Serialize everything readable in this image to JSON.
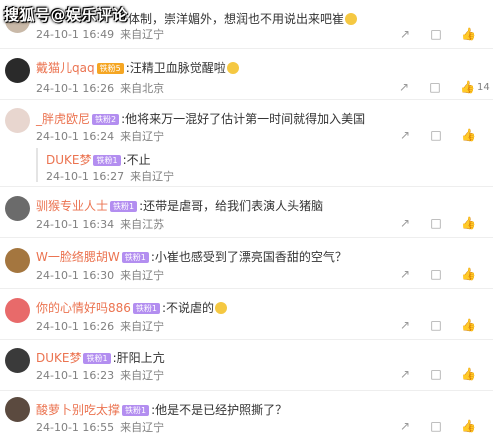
{
  "watermark": "搜狐号@娱乐评论",
  "top": {
    "text": "体制，崇洋媚外，想润也不用说出来吧崔",
    "date": "24-10-1 16:49",
    "location": "来自辽宁"
  },
  "comments": [
    {
      "name": "戴猫儿qaq",
      "badge": "铁粉5",
      "badge_style": "gold",
      "text": ":汪精卫血脉觉醒啦",
      "date": "24-10-1 16:26",
      "location": "来自北京",
      "likes": "14"
    },
    {
      "name": "_胖虎欧尼",
      "badge": "铁粉2",
      "text": ":他将来万一混好了估计第一时间就得加入美国",
      "date": "24-10-1 16:24",
      "location": "来自辽宁",
      "likes": ""
    },
    {
      "name": "DUKE梦",
      "badge": "铁粉1",
      "text": ":不止",
      "date": "24-10-1 16:27",
      "location": "来自辽宁",
      "reply": true
    },
    {
      "name": "驯猴专业人士",
      "badge": "铁粉1",
      "text": ":还带是虐哥，给我们表演人头猪脑",
      "date": "24-10-1 16:34",
      "location": "来自江苏",
      "likes": ""
    },
    {
      "name": "W一脸络腮胡W",
      "badge": "铁粉1",
      "text": ":小崔也感受到了漂亮国香甜的空气？",
      "date": "24-10-1 16:30",
      "location": "来自辽宁",
      "likes": ""
    },
    {
      "name": "你的心情好吗886",
      "badge": "铁粉1",
      "text": ":不说虐的",
      "date": "24-10-1 16:26",
      "location": "来自辽宁",
      "likes": ""
    },
    {
      "name": "DUKE梦",
      "badge": "铁粉1",
      "text": ":肝阳上亢",
      "date": "24-10-1 16:23",
      "location": "来自辽宁",
      "likes": ""
    },
    {
      "name": "酸萝卜别吃太撑",
      "badge": "铁粉1",
      "text": ":他是不是已经护照撕了？",
      "date": "24-10-1 16:55",
      "location": "来自辽宁",
      "likes": ""
    }
  ],
  "icons": {
    "share": "share-icon",
    "comment": "comment-icon",
    "like": "thumbs-up-icon"
  }
}
